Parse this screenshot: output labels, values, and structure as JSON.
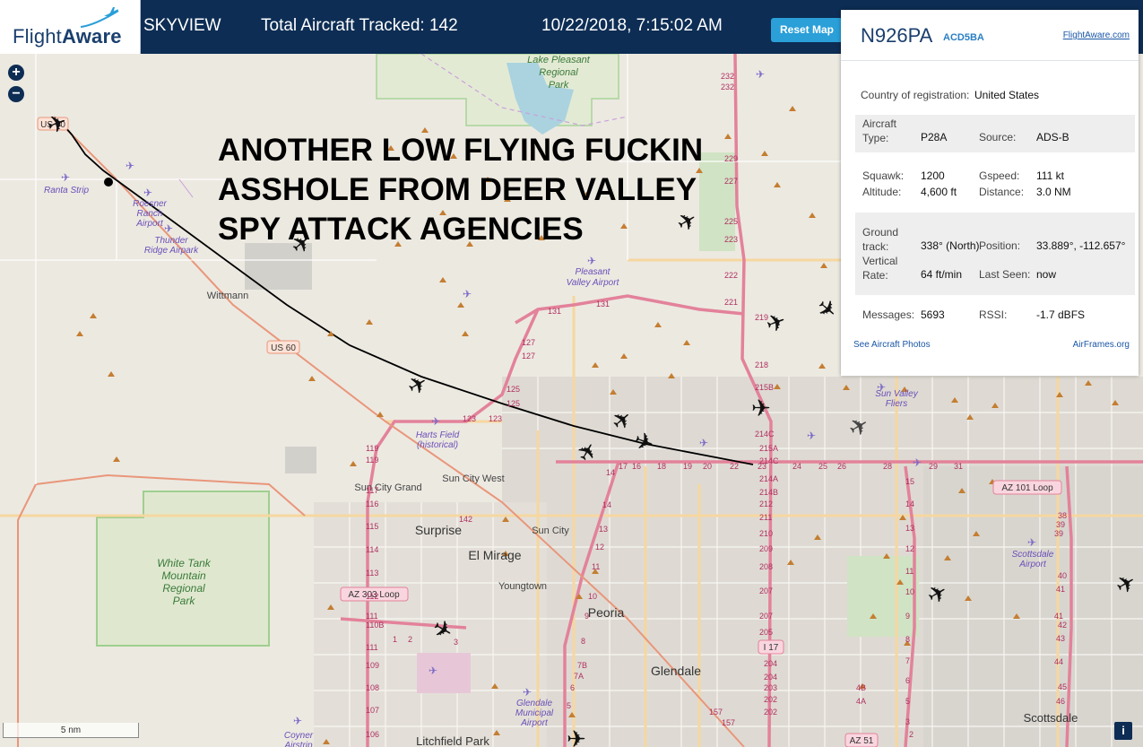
{
  "header": {
    "brand": "FlightAware",
    "brand_bold": "Aware",
    "brand_plain": "Flight",
    "app_name": "SKYVIEW",
    "tracked": "Total Aircraft Tracked: 142",
    "datetime": "10/22/2018, 7:15:02 AM",
    "reset_label": "Reset Map"
  },
  "zoom": {
    "in": "+",
    "out": "−"
  },
  "overlay_caption": [
    "ANOTHER LOW FLYING FUCKIN",
    "ASSHOLE FROM DEER VALLEY",
    "SPY ATTACK AGENCIES"
  ],
  "panel": {
    "ident": "N926PA",
    "hex": "ACD5BA",
    "fa_link": "FlightAware.com",
    "country_label": "Country of registration:",
    "country": "United States",
    "aircraft_type_label": "Aircraft\nType:",
    "aircraft_type": "P28A",
    "source_label": "Source:",
    "source": "ADS-B",
    "squawk_label": "Squawk:",
    "squawk": "1200",
    "gspeed_label": "Gspeed:",
    "gspeed": "111 kt",
    "altitude_label": "Altitude:",
    "altitude": "4,600 ft",
    "distance_label": "Distance:",
    "distance": "3.0 NM",
    "ground_track_label": "Ground\ntrack:",
    "ground_track": "338° (North)",
    "position_label": "Position:",
    "position": "33.889°, -112.657°",
    "vertical_rate_label": "Vertical\nRate:",
    "vertical_rate": "64 ft/min",
    "last_seen_label": "Last Seen:",
    "last_seen": "now",
    "messages_label": "Messages:",
    "messages": "5693",
    "rssi_label": "RSSI:",
    "rssi": "-1.7 dBFS",
    "photos_link": "See Aircraft Photos",
    "airframes_link": "AirFrames.org"
  },
  "scale_label": "5 nm",
  "info_label": "i",
  "map": {
    "places": {
      "lake_pleasant": "Lake Pleasant\nRegional\nPark",
      "ranta": "Ranta Strip",
      "roesner": "Roesner\nRanch\nAirport",
      "thunder": "Thunder\nRidge Airpark",
      "wittmann": "Wittmann",
      "pleasant_valley": "Pleasant\nValley Airport",
      "harts": "Harts Field\n(historical)",
      "sun_city_grand": "Sun City Grand",
      "sun_city_west": "Sun City West",
      "sun_city": "Sun City",
      "surprise": "Surprise",
      "el_mirage": "El Mirage",
      "youngtown": "Youngtown",
      "peoria": "Peoria",
      "glendale": "Glendale",
      "glendale_airport": "Glendale\nMunicipal\nAirport",
      "litchfield": "Litchfield Park",
      "coyner": "Coyner\nAirstrip",
      "white_tank": "White Tank\nMountain\nRegional\nPark",
      "sun_valley": "Sun Valley\nFliers",
      "scottsdale_airport": "Scottsdale\nAirport",
      "scottsdale": "Scottsdale"
    },
    "shields": {
      "us60_a": "US 60",
      "us60_b": "US 60",
      "az303": "AZ 303 Loop",
      "az101": "AZ 101 Loop",
      "i17": "17",
      "az51": "AZ 51"
    },
    "exits_i17": [
      "232",
      "232",
      "229",
      "227",
      "225",
      "223",
      "222",
      "221",
      "219",
      "218",
      "215B",
      "214C",
      "215A",
      "214C",
      "214A",
      "214B",
      "212",
      "211",
      "210",
      "209",
      "208",
      "207",
      "207",
      "205",
      "204",
      "204",
      "203",
      "202",
      "202"
    ],
    "exits_101": [
      "17",
      "16",
      "18",
      "19",
      "20",
      "22",
      "23",
      "24",
      "25",
      "26",
      "28",
      "29",
      "31"
    ],
    "exits_303": [
      "119",
      "119",
      "117",
      "116",
      "115",
      "114",
      "113",
      "112",
      "111",
      "110B",
      "111",
      "109",
      "108",
      "107",
      "106"
    ],
    "exits_101w": [
      "14",
      "14",
      "13",
      "12",
      "11",
      "10",
      "9",
      "8",
      "7B",
      "7A",
      "6",
      "5"
    ],
    "exits_east": [
      "15",
      "14",
      "13",
      "12",
      "11",
      "10",
      "9",
      "8",
      "7",
      "6",
      "5",
      "4B",
      "4A",
      "3",
      "2"
    ],
    "exits_far_east": [
      "38",
      "39",
      "39",
      "40",
      "41",
      "41",
      "42",
      "43",
      "44",
      "45",
      "46"
    ],
    "route_nums": [
      "131",
      "131",
      "127",
      "127",
      "125",
      "125",
      "123",
      "123",
      "142",
      "157",
      "157",
      "1",
      "2",
      "3"
    ]
  }
}
